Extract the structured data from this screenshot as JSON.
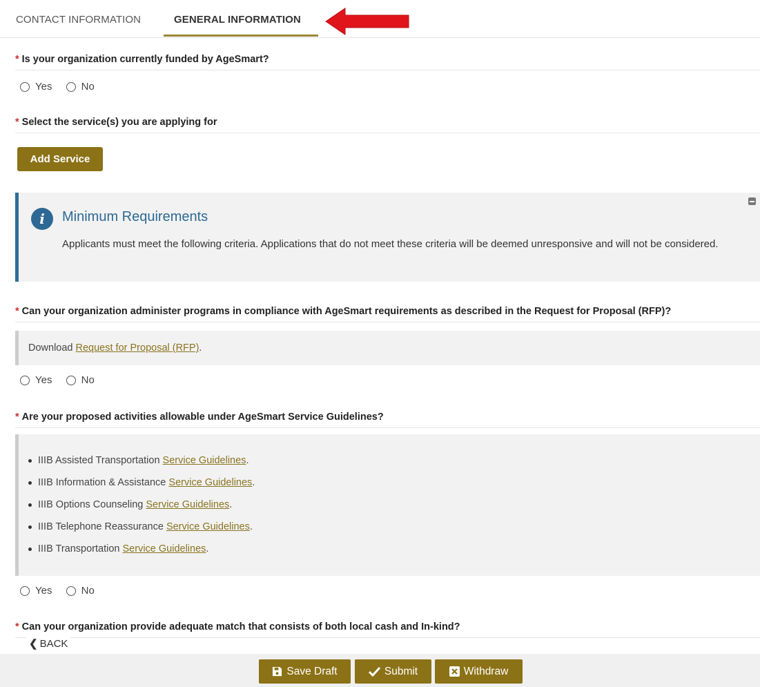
{
  "tabs": {
    "contact": "CONTACT INFORMATION",
    "general": "GENERAL INFORMATION"
  },
  "q1": {
    "required_mark": "*",
    "text": "Is your organization currently funded by AgeSmart?",
    "yes": "Yes",
    "no": "No"
  },
  "q2": {
    "required_mark": "*",
    "text": "Select the service(s) you are applying for",
    "add_button": "Add Service"
  },
  "info": {
    "title": "Minimum Requirements",
    "text": "Applicants must meet the following criteria.  Applications that do not meet these criteria will be deemed unresponsive and will not be considered."
  },
  "q3": {
    "required_mark": "*",
    "text": "Can your organization administer programs in compliance with AgeSmart requirements as described in the Request for Proposal (RFP)?",
    "note_prefix": "Download ",
    "note_link": "Request for Proposal (RFP)",
    "note_suffix": ".",
    "yes": "Yes",
    "no": "No"
  },
  "q4": {
    "required_mark": "*",
    "text": "Are your proposed activities allowable under AgeSmart Service Guidelines?",
    "items": [
      {
        "label": "IIIB Assisted Transportation ",
        "link": "Service Guidelines",
        "suffix": "."
      },
      {
        "label": "IIIB Information & Assistance ",
        "link": "Service Guidelines",
        "suffix": "."
      },
      {
        "label": "IIIB Options Counseling ",
        "link": "Service Guidelines",
        "suffix": "."
      },
      {
        "label": "IIIB Telephone Reassurance ",
        "link": "Service Guidelines",
        "suffix": "."
      },
      {
        "label": "IIIB Transportation ",
        "link": "Service Guidelines",
        "suffix": "."
      }
    ],
    "yes": "Yes",
    "no": "No"
  },
  "q5": {
    "required_mark": "*",
    "text": "Can your organization provide adequate match that consists of both local cash and In-kind?"
  },
  "back": "BACK",
  "footer": {
    "save_draft": "Save Draft",
    "submit": "Submit",
    "withdraw": "Withdraw"
  },
  "colors": {
    "accent": "#8c7216",
    "info_blue": "#2d6994",
    "required": "#c9302c",
    "arrow": "#e0141b"
  }
}
